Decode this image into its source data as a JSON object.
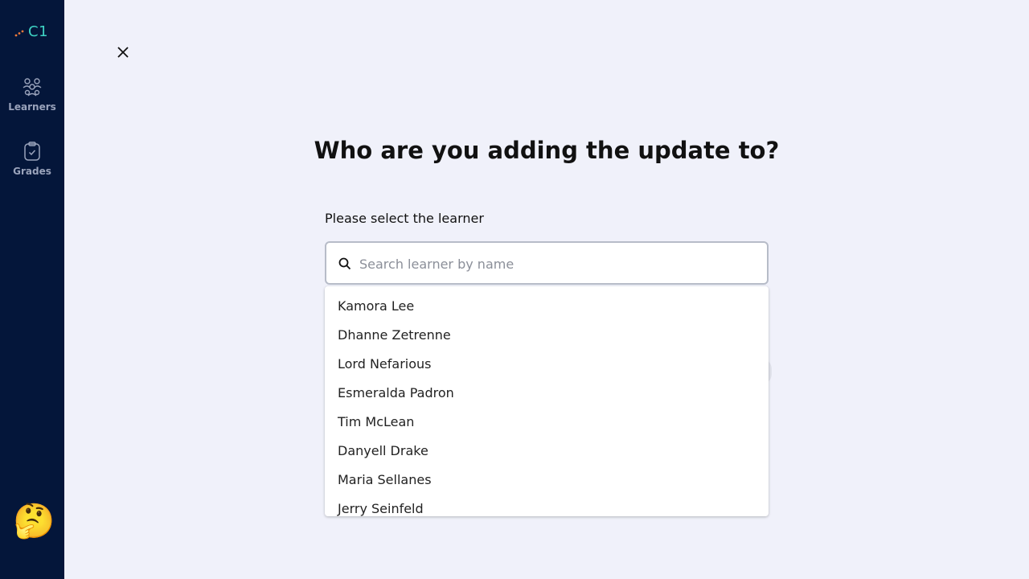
{
  "sidebar": {
    "logo_text": "C1",
    "nav": [
      {
        "label": "Learners",
        "icon": "users-group-icon"
      },
      {
        "label": "Grades",
        "icon": "clipboard-check-icon"
      }
    ],
    "avatar_emoji": "🤔"
  },
  "modal": {
    "close_icon": "close-icon",
    "title": "Who are you adding the update to?",
    "field_label": "Please select the learner",
    "search": {
      "placeholder": "Search learner by name",
      "value": ""
    },
    "options": [
      "Kamora Lee",
      "Dhanne Zetrenne",
      "Lord Nefarious",
      "Esmeralda Padron",
      "Tim McLean",
      "Danyell Drake",
      "Maria Sellanes",
      "Jerry Seinfeld"
    ]
  },
  "colors": {
    "sidebar_bg": "#04163a",
    "page_bg": "#f0f1fa",
    "logo_accent": "#3ed3c4",
    "logo_dots": "#f07a3a"
  }
}
